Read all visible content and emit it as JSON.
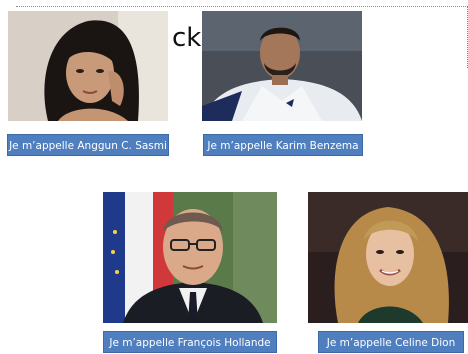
{
  "slide": {
    "title_fragment": "ck"
  },
  "cards": [
    {
      "caption": "Je m’appelle Anggun C. Sasmi"
    },
    {
      "caption": "Je m’appelle Karim Benzema"
    },
    {
      "caption": "Je m’appelle François Hollande"
    },
    {
      "caption": "Je m’appelle Celine Dion"
    }
  ]
}
